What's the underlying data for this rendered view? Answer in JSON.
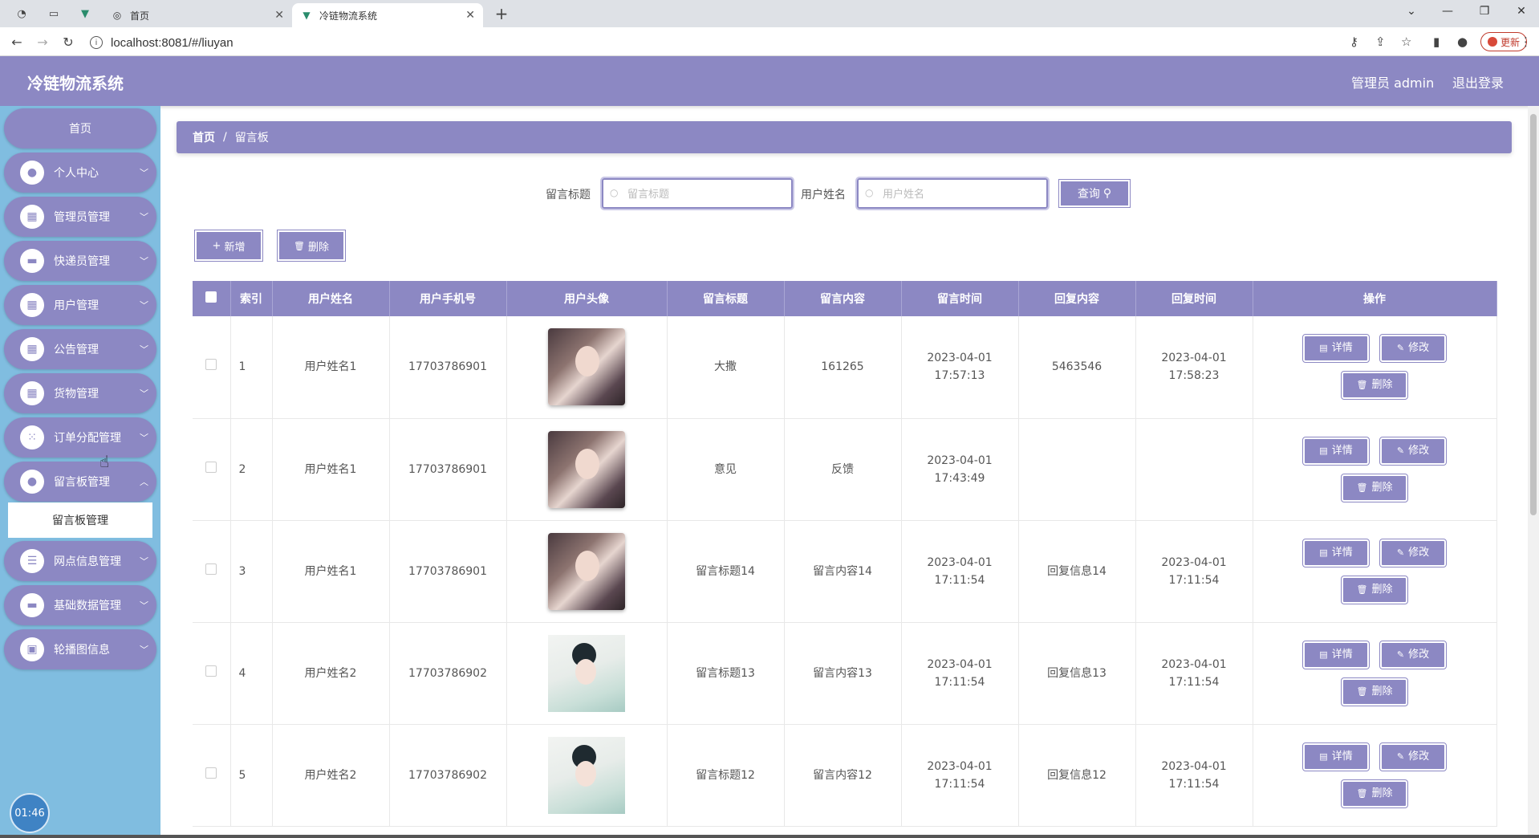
{
  "browser": {
    "tabs": [
      {
        "label": "首页",
        "active": false
      },
      {
        "label": "冷链物流系统",
        "active": true
      }
    ],
    "new_tab": "+",
    "url": "localhost:8081/#/liuyan",
    "update_label": "更新"
  },
  "header": {
    "title": "冷链物流系统",
    "user": "管理员 admin",
    "logout": "退出登录"
  },
  "sidebar": {
    "home": "首页",
    "items": [
      {
        "label": "个人中心",
        "icon": "person-icon"
      },
      {
        "label": "管理员管理",
        "icon": "grid-icon"
      },
      {
        "label": "快递员管理",
        "icon": "monitor-icon"
      },
      {
        "label": "用户管理",
        "icon": "grid-icon"
      },
      {
        "label": "公告管理",
        "icon": "grid-icon"
      },
      {
        "label": "货物管理",
        "icon": "grid-icon"
      },
      {
        "label": "订单分配管理",
        "icon": "apps-icon"
      },
      {
        "label": "留言板管理",
        "icon": "person-icon"
      },
      {
        "label": "网点信息管理",
        "icon": "sliders-icon"
      },
      {
        "label": "基础数据管理",
        "icon": "monitor-icon"
      },
      {
        "label": "轮播图信息",
        "icon": "suitcase-icon"
      }
    ],
    "sub_item": "留言板管理",
    "clock": "01:46"
  },
  "breadcrumb": {
    "home": "首页",
    "sep": "/",
    "current": "留言板"
  },
  "search": {
    "title_label": "留言标题",
    "title_placeholder": "留言标题",
    "title_value": "",
    "name_label": "用户姓名",
    "name_placeholder": "用户姓名",
    "name_value": "",
    "query_button": "查询"
  },
  "toolbar": {
    "add": "新增",
    "delete": "删除"
  },
  "table": {
    "columns": [
      "索引",
      "用户姓名",
      "用户手机号",
      "用户头像",
      "留言标题",
      "留言内容",
      "留言时间",
      "回复内容",
      "回复时间",
      "操作"
    ],
    "rows": [
      {
        "index": "1",
        "name": "用户姓名1",
        "phone": "17703786901",
        "avatar": "a1",
        "title": "大撒",
        "content": "161265",
        "time": "2023-04-01 17:57:13",
        "reply": "5463546",
        "reply_time": "2023-04-01 17:58:23"
      },
      {
        "index": "2",
        "name": "用户姓名1",
        "phone": "17703786901",
        "avatar": "a1",
        "title": "意见",
        "content": "反馈",
        "time": "2023-04-01 17:43:49",
        "reply": "",
        "reply_time": ""
      },
      {
        "index": "3",
        "name": "用户姓名1",
        "phone": "17703786901",
        "avatar": "a1",
        "title": "留言标题14",
        "content": "留言内容14",
        "time": "2023-04-01 17:11:54",
        "reply": "回复信息14",
        "reply_time": "2023-04-01 17:11:54"
      },
      {
        "index": "4",
        "name": "用户姓名2",
        "phone": "17703786902",
        "avatar": "a2",
        "title": "留言标题13",
        "content": "留言内容13",
        "time": "2023-04-01 17:11:54",
        "reply": "回复信息13",
        "reply_time": "2023-04-01 17:11:54"
      },
      {
        "index": "5",
        "name": "用户姓名2",
        "phone": "17703786902",
        "avatar": "a2",
        "title": "留言标题12",
        "content": "留言内容12",
        "time": "2023-04-01 17:11:54",
        "reply": "回复信息12",
        "reply_time": "2023-04-01 17:11:54"
      }
    ],
    "actions": {
      "detail": "详情",
      "edit": "修改",
      "delete": "删除"
    }
  },
  "colors": {
    "primary": "#8c88c3",
    "sidebar_bg": "#80bde0"
  }
}
